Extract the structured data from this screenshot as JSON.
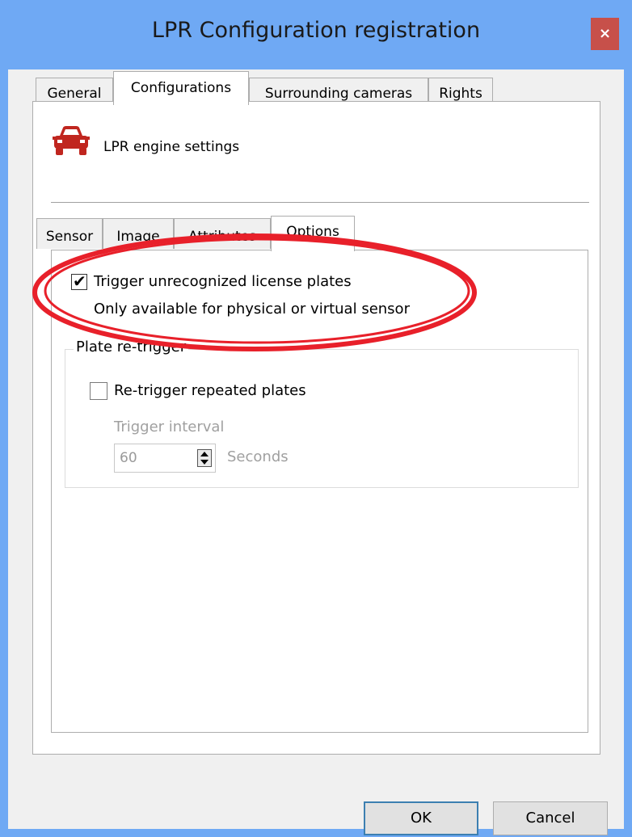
{
  "window": {
    "title": "LPR Configuration registration",
    "close_label": "×",
    "accent_color": "#6fa9f4",
    "close_color": "#c7504a"
  },
  "tabs": [
    {
      "label": "General"
    },
    {
      "label": "Configurations",
      "active": true
    },
    {
      "label": "Surrounding cameras"
    },
    {
      "label": "Rights"
    }
  ],
  "engine": {
    "icon": "car-icon",
    "label": "LPR engine settings"
  },
  "subtabs": [
    {
      "label": "Sensor"
    },
    {
      "label": "Image"
    },
    {
      "label": "Attributes"
    },
    {
      "label": "Options",
      "active": true
    }
  ],
  "options": {
    "trigger_unrecognized": {
      "label": "Trigger unrecognized license plates",
      "checked": true
    },
    "note": "Only available for physical or virtual sensor",
    "group_title": "Plate re-trigger",
    "retrigger": {
      "label": "Re-trigger repeated plates",
      "checked": false
    },
    "interval_label": "Trigger interval",
    "interval_value": "60",
    "interval_unit": "Seconds"
  },
  "buttons": {
    "ok": "OK",
    "cancel": "Cancel"
  },
  "annotation_color": "#e8202a"
}
